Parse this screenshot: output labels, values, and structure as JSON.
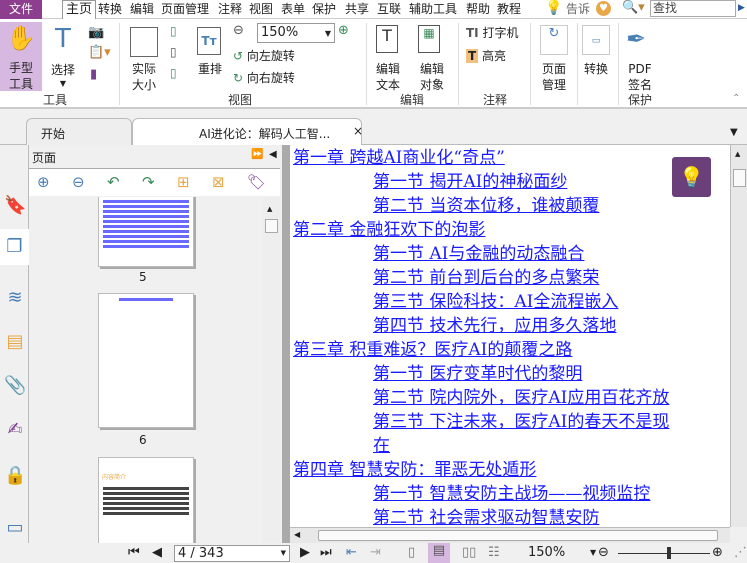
{
  "menu": {
    "file": "文件",
    "items": [
      "主页",
      "转换",
      "编辑",
      "页面管理",
      "注释",
      "视图",
      "表单",
      "保护",
      "共享",
      "互联",
      "辅助工具",
      "帮助",
      "教程"
    ],
    "tell": "告诉",
    "search_placeholder": "查找"
  },
  "ribbon": {
    "hand": "手型\n工具",
    "select": "选择",
    "group_tools": "工具",
    "actual": "实际\n大小",
    "reflow": "重排",
    "zoom": "150%",
    "rotate_left": "向左旋转",
    "rotate_right": "向右旋转",
    "group_view": "视图",
    "edit_text": "编辑\n文本",
    "edit_object": "编辑\n对象",
    "group_edit": "编辑",
    "typewriter": "打字机",
    "highlight": "高亮",
    "group_comment": "注释",
    "page_mgmt": "页面\n管理",
    "convert": "转换",
    "pdf_sign": "PDF\n签名",
    "group_protect": "保护"
  },
  "tabs": {
    "start": "开始",
    "doc": "AI进化论：解码人工智...",
    "close": "×"
  },
  "pane": {
    "title": "页面",
    "pages": [
      "5",
      "6"
    ],
    "thumb7_title": "内容简介"
  },
  "toc": [
    {
      "t": "第一章 跨越AI商业化“奇点”",
      "lvl": 0
    },
    {
      "t": "第一节 揭开AI的神秘面纱",
      "lvl": 1
    },
    {
      "t": "第二节 当资本位移，谁被颠覆",
      "lvl": 1
    },
    {
      "t": "第二章 金融狂欢下的泡影",
      "lvl": 0
    },
    {
      "t": "第一节 AI与金融的动态融合",
      "lvl": 1
    },
    {
      "t": "第二节 前台到后台的多点繁荣",
      "lvl": 1
    },
    {
      "t": "第三节 保险科技：AI全流程嵌入",
      "lvl": 1
    },
    {
      "t": "第四节 技术先行，应用多久落地",
      "lvl": 1
    },
    {
      "t": "第三章 积重难返？医疗AI的颠覆之路",
      "lvl": 0
    },
    {
      "t": "第一节 医疗变革时代的黎明",
      "lvl": 1
    },
    {
      "t": "第二节 院内院外，医疗AI应用百花齐放",
      "lvl": 1
    },
    {
      "t": "第三节 下注未来，医疗AI的春天不是现",
      "lvl": 1
    },
    {
      "t": "在",
      "lvl": 1
    },
    {
      "t": "第四章 智慧安防：罪恶无处遁形",
      "lvl": 0
    },
    {
      "t": "第一节 智慧安防主战场——视频监控",
      "lvl": 1
    },
    {
      "t": "第二节 社会需求驱动智慧安防",
      "lvl": 1
    }
  ],
  "status": {
    "page": "4 / 343",
    "zoom": "150%"
  },
  "colors": {
    "accent": "#8e3e8f",
    "link": "#1a1aff",
    "bulb": "#6b3f7a"
  }
}
